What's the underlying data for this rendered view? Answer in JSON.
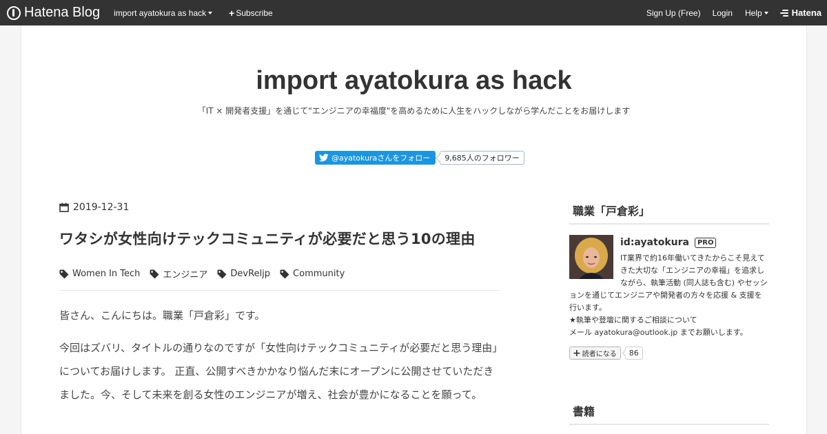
{
  "topbar": {
    "brand": "Hatena Blog",
    "blog_menu": "import ayatokura as hack",
    "subscribe": "Subscribe",
    "signup": "Sign Up (Free)",
    "login": "Login",
    "help": "Help",
    "hatena": "Hatena"
  },
  "header": {
    "title": "import ayatokura as hack",
    "description": "「IT × 開発者支援」を通じて\"エンジニアの幸福度\"を高めるために人生をハックしながら学んだことをお届けします",
    "twitter_follow": "@ayatokuraさんをフォロー",
    "twitter_followers": "9,685人のフォロワー"
  },
  "article": {
    "date": "2019-12-31",
    "title": "ワタシが女性向けテックコミュニティが必要だと思う10の理由",
    "categories": [
      "Women In Tech",
      "エンジニア",
      "DevReljp",
      "Community"
    ],
    "paragraphs": [
      "皆さん、こんにちは。職業「戸倉彩」です。",
      "今回はズバリ、タイトルの通りなのですが「女性向けテックコミュニティが必要だと思う理由」についてお届けします。 正直、公開すべきかかなり悩んだ末にオープンに公開させていただきました。今、そして未来を創る女性のエンジニアが増え、社会が豊かになることを願って。"
    ]
  },
  "sidebar": {
    "profile_title": "職業「戸倉彩」",
    "profile_id": "id:ayatokura",
    "pro_badge": "PRO",
    "profile_description": "IT業界で約16年働いてきたからこそ見えてきた大切な「エンジニアの幸福」を追求しながら、執筆活動 (同人誌も含む) やセッションを通じてエンジニアや開発者の方々を応援 & 支援を行います。\n★執筆や登壇に関するご相談について\nメール ayatokura@outlook.jp までお願いします。",
    "reader_button": "読者になる",
    "reader_count": "86",
    "books_title": "書籍"
  },
  "colors": {
    "topbar_bg": "#333333",
    "twitter_blue": "#1b95e0",
    "page_bg": "#f5f5f5"
  },
  "icons": [
    "hatena-blog-logo-icon",
    "caret-down-icon",
    "plus-icon",
    "hatena-logo-icon",
    "twitter-bird-icon",
    "calendar-icon",
    "tag-icon"
  ]
}
